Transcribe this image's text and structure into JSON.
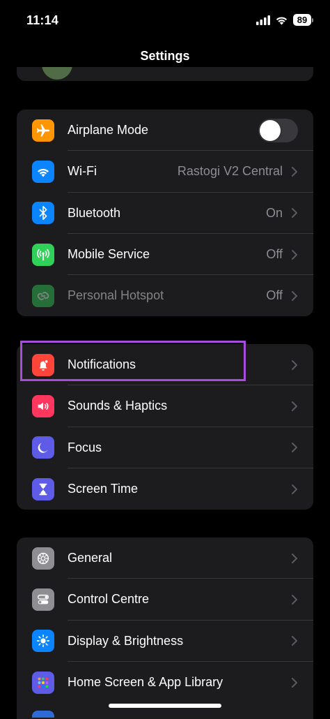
{
  "status_bar": {
    "time": "11:14",
    "battery": "89"
  },
  "nav": {
    "title": "Settings"
  },
  "groups": [
    {
      "rows": [
        {
          "label": "Airplane Mode",
          "icon": "airplane-icon",
          "color": "#ff9500",
          "toggle": false
        },
        {
          "label": "Wi-Fi",
          "value": "Rastogi V2 Central",
          "icon": "wifi-icon",
          "color": "#0a84ff"
        },
        {
          "label": "Bluetooth",
          "value": "On",
          "icon": "bluetooth-icon",
          "color": "#0a84ff"
        },
        {
          "label": "Mobile Service",
          "value": "Off",
          "icon": "antenna-icon",
          "color": "#30d158"
        },
        {
          "label": "Personal Hotspot",
          "value": "Off",
          "icon": "hotspot-icon",
          "color": "#30d158"
        }
      ]
    },
    {
      "rows": [
        {
          "label": "Notifications",
          "icon": "notification-bell-icon",
          "color": "#ff453a"
        },
        {
          "label": "Sounds & Haptics",
          "icon": "speaker-icon",
          "color": "#ff375f"
        },
        {
          "label": "Focus",
          "icon": "moon-icon",
          "color": "#5e5ce6"
        },
        {
          "label": "Screen Time",
          "icon": "hourglass-icon",
          "color": "#5e5ce6"
        }
      ]
    },
    {
      "rows": [
        {
          "label": "General",
          "icon": "gear-icon",
          "color": "#8e8e93"
        },
        {
          "label": "Control Centre",
          "icon": "toggles-icon",
          "color": "#8e8e93"
        },
        {
          "label": "Display & Brightness",
          "icon": "sun-icon",
          "color": "#0a84ff"
        },
        {
          "label": "Home Screen & App Library",
          "icon": "app-grid-icon",
          "color": "#5e5ce6"
        }
      ]
    }
  ],
  "highlight_color": "#a64ddb"
}
